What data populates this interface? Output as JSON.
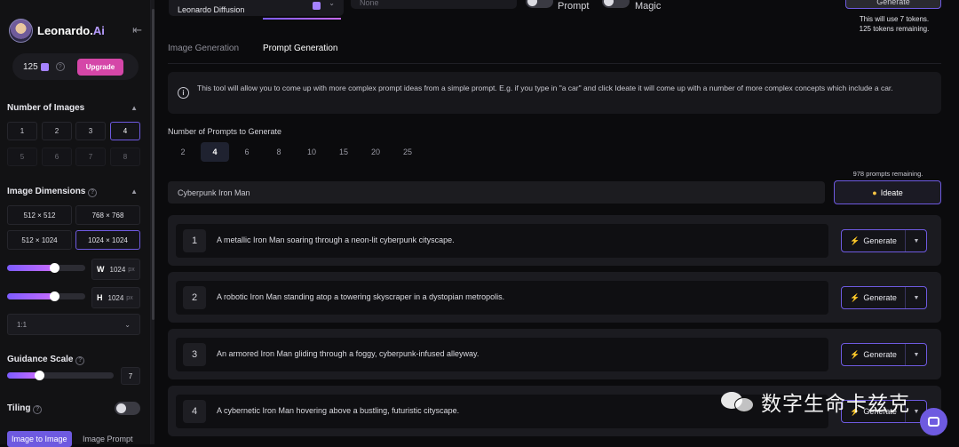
{
  "sidebar": {
    "brand_name": "Leonardo.",
    "brand_ai": "Ai",
    "collapse_icon": "collapse-left-icon",
    "tokens": "125",
    "upgrade_label": "Upgrade",
    "number_of_images": {
      "title": "Number of Images",
      "options": [
        "1",
        "2",
        "3",
        "4",
        "5",
        "6",
        "7",
        "8"
      ],
      "selected": "4"
    },
    "image_dimensions": {
      "title": "Image Dimensions",
      "options": [
        "512 × 512",
        "768 × 768",
        "512 × 1024",
        "1024 × 1024"
      ],
      "selected": "1024 × 1024"
    },
    "width": {
      "label": "W",
      "value": "1024",
      "unit": "px",
      "slider_level": 0.6
    },
    "height": {
      "label": "H",
      "value": "1024",
      "unit": "px",
      "slider_level": 0.6
    },
    "aspect_ratio": "1:1",
    "guidance_scale": {
      "title": "Guidance Scale",
      "value": "7",
      "slider_level": 0.3
    },
    "tiling": {
      "title": "Tiling",
      "enabled": false
    },
    "bottom_tabs": [
      "Image to Image",
      "Image Prompt"
    ]
  },
  "header": {
    "model": "Leonardo Diffusion",
    "style": "None",
    "toggle_prompt_label": "Prompt",
    "toggle_magic_label": "Magic",
    "generate_label": "Generate",
    "token_note_line1": "This will use 7 tokens.",
    "token_note_line2": "125 tokens remaining."
  },
  "tabs": [
    {
      "label": "Image Generation",
      "active": false
    },
    {
      "label": "Prompt Generation",
      "active": true
    }
  ],
  "info": {
    "text": "This tool will allow you to come up with more complex prompt ideas from a simple prompt. E.g. if you type in \"a car\" and click Ideate it will come up with a number of more complex concepts which include a car."
  },
  "prompt_count": {
    "label": "Number of Prompts to Generate",
    "options": [
      "2",
      "4",
      "6",
      "8",
      "10",
      "15",
      "20",
      "25"
    ],
    "selected": "4"
  },
  "prompts_remaining": "978 prompts remaining.",
  "prompt_input": {
    "value": "Cyberpunk Iron Man"
  },
  "ideate_label": "Ideate",
  "results": [
    {
      "num": "1",
      "text": "A metallic Iron Man soaring through a neon-lit cyberpunk cityscape.",
      "button": "Generate"
    },
    {
      "num": "2",
      "text": "A robotic Iron Man standing atop a towering skyscraper in a dystopian metropolis.",
      "button": "Generate"
    },
    {
      "num": "3",
      "text": "An armored Iron Man gliding through a foggy, cyberpunk-infused alleyway.",
      "button": "Generate"
    },
    {
      "num": "4",
      "text": "A cybernetic Iron Man hovering above a bustling, futuristic cityscape.",
      "button": "Generate"
    }
  ],
  "watermark": "数字生命卡兹克",
  "colors": {
    "accent": "#6e5ae0",
    "upgrade": "#d546a8",
    "bolt": "#f58a2c"
  }
}
